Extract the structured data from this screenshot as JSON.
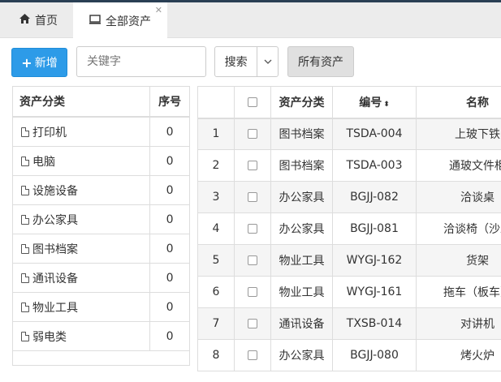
{
  "tabs": [
    {
      "label": "首页",
      "icon": "home-icon"
    },
    {
      "label": "全部资产",
      "icon": "monitor-icon"
    }
  ],
  "toolbar": {
    "add_label": "新增",
    "search_placeholder": "关键字",
    "search_label": "搜索",
    "all_assets_label": "所有资产"
  },
  "categories": {
    "header": {
      "name": "资产分类",
      "seq": "序号"
    },
    "items": [
      {
        "name": "打印机",
        "seq": "0"
      },
      {
        "name": "电脑",
        "seq": "0"
      },
      {
        "name": "设施设备",
        "seq": "0"
      },
      {
        "name": "办公家具",
        "seq": "0"
      },
      {
        "name": "图书档案",
        "seq": "0"
      },
      {
        "name": "通讯设备",
        "seq": "0"
      },
      {
        "name": "物业工具",
        "seq": "0"
      },
      {
        "name": "弱电类",
        "seq": "0"
      }
    ]
  },
  "assets": {
    "columns": {
      "category": "资产分类",
      "code": "编号",
      "name": "名称"
    },
    "rows": [
      {
        "index": "1",
        "category": "图书档案",
        "code": "TSDA-004",
        "name": "上玻下铁"
      },
      {
        "index": "2",
        "category": "图书档案",
        "code": "TSDA-003",
        "name": "通玻文件柜"
      },
      {
        "index": "3",
        "category": "办公家具",
        "code": "BGJJ-082",
        "name": "洽谈桌"
      },
      {
        "index": "4",
        "category": "办公家具",
        "code": "BGJJ-081",
        "name": "洽谈椅（沙发"
      },
      {
        "index": "5",
        "category": "物业工具",
        "code": "WYGJ-162",
        "name": "货架"
      },
      {
        "index": "6",
        "category": "物业工具",
        "code": "WYGJ-161",
        "name": "拖车（板车）"
      },
      {
        "index": "7",
        "category": "通讯设备",
        "code": "TXSB-014",
        "name": "对讲机"
      },
      {
        "index": "8",
        "category": "办公家具",
        "code": "BGJJ-080",
        "name": "烤火炉"
      }
    ]
  },
  "colors": {
    "primary": "#2d9be8",
    "tabbar": "#ececec",
    "stripe": "#f5f5f5"
  }
}
